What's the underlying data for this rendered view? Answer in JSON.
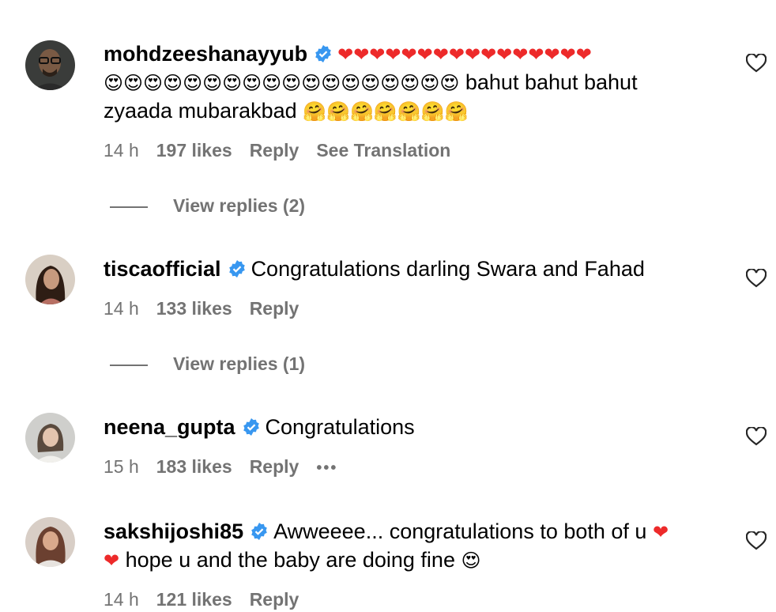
{
  "comments": [
    {
      "username": "mohdzeeshanayyub",
      "text_line1_hearts": "❤❤❤❤❤❤❤❤❤❤❤❤❤❤❤❤",
      "text_line2_emoji": "😍😍😍😍😍😍😍😍😍😍😍😍😍😍😍😍😍😍",
      "text_line2": "bahut bahut bahut",
      "text_line3": "zyaada mubarakbad",
      "text_line3_emoji": "🤗🤗🤗🤗🤗🤗🤗",
      "time": "14 h",
      "likes": "197 likes",
      "reply": "Reply",
      "extra": "See Translation",
      "view_replies": "View replies (2)"
    },
    {
      "username": "tiscaofficial",
      "text": "Congratulations darling Swara and Fahad",
      "time": "14 h",
      "likes": "133 likes",
      "reply": "Reply",
      "view_replies": "View replies (1)"
    },
    {
      "username": "neena_gupta",
      "text": "Congratulations",
      "time": "15 h",
      "likes": "183 likes",
      "reply": "Reply",
      "more": "•••"
    },
    {
      "username": "sakshijoshi85",
      "text_line1": "Awweeee... congratulations to both of u",
      "text_line2": "hope u and the baby are doing fine",
      "heart": "❤",
      "smile": "😍",
      "time": "14 h",
      "likes": "121 likes",
      "reply": "Reply"
    }
  ],
  "colors": {
    "verified": "#3897f0",
    "meta": "#737373",
    "heart_red": "#ed2a2a"
  }
}
